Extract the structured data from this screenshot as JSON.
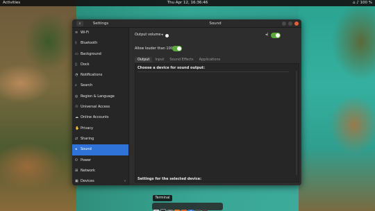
{
  "topbar": {
    "activities": "Activities",
    "clock": "Thu Apr 12, 16:36:46",
    "tray": "100 %"
  },
  "window": {
    "left_title": "Settings",
    "right_title": "Sound"
  },
  "sidebar": {
    "items": [
      {
        "label": "Wi-Fi",
        "icon": "wifi-icon"
      },
      {
        "label": "Bluetooth",
        "icon": "bluetooth-icon"
      },
      {
        "label": "Background",
        "icon": "background-icon"
      },
      {
        "label": "Dock",
        "icon": "dock-icon"
      },
      {
        "label": "Notifications",
        "icon": "bell-icon"
      },
      {
        "label": "Search",
        "icon": "search-icon"
      },
      {
        "label": "Region & Language",
        "icon": "globe-icon"
      },
      {
        "label": "Universal Access",
        "icon": "accessibility-icon"
      },
      {
        "label": "Online Accounts",
        "icon": "cloud-icon"
      },
      {
        "label": "Privacy",
        "icon": "hand-icon"
      },
      {
        "label": "Sharing",
        "icon": "share-icon"
      },
      {
        "label": "Sound",
        "icon": "speaker-icon",
        "active": true
      },
      {
        "label": "Power",
        "icon": "power-icon"
      },
      {
        "label": "Network",
        "icon": "network-icon"
      },
      {
        "label": "Devices",
        "icon": "devices-icon"
      }
    ]
  },
  "sound": {
    "output_volume_label": "Output volume",
    "output_volume_level": 0.1,
    "allow_louder_label": "Allow louder than 100%",
    "allow_louder_enabled": true,
    "tabs": [
      "Output",
      "Input",
      "Sound Effects",
      "Applications"
    ],
    "active_tab": "Output",
    "choose_device_label": "Choose a device for sound output:",
    "settings_device_label": "Settings for the selected device:"
  },
  "dock": {
    "tooltip": "Terminal",
    "apps": [
      "files-icon",
      "terminal-icon",
      "settings-icon",
      "browser-icon",
      "software-icon",
      "help-icon",
      "monitor-icon",
      "apps-grid-icon"
    ]
  },
  "colors": {
    "accent": "#2f73d8",
    "toggle_on": "#5aa83a",
    "window_bg": "#2d2d2d",
    "close_button": "#e0603c"
  }
}
